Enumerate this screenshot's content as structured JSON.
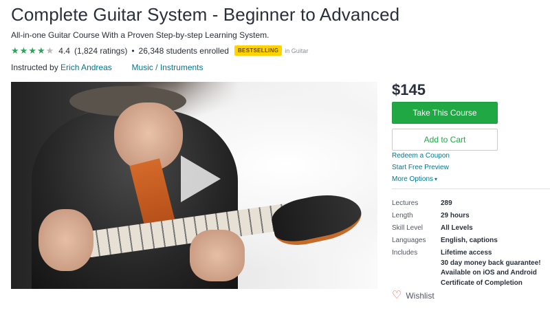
{
  "course": {
    "title": "Complete Guitar System - Beginner to Advanced",
    "subtitle": "All-in-one Guitar Course With a Proven Step-by-step Learning System.",
    "rating_value": "4.4",
    "rating_stars": 4.4,
    "ratings_count": "(1,824 ratings)",
    "separator": "•",
    "students": "26,348 students enrolled",
    "badge": "BESTSELLING",
    "category_note": "in Guitar",
    "instructed_by_label": "Instructed by",
    "instructor": "Erich Andreas",
    "breadcrumb_1": "Music",
    "breadcrumb_sep": "/",
    "breadcrumb_2": "Instruments"
  },
  "video": {
    "play_icon": "play-icon"
  },
  "sidebar": {
    "price": "$145",
    "take_course": "Take This Course",
    "add_to_cart": "Add to Cart",
    "redeem_coupon": "Redeem a Coupon",
    "free_preview": "Start Free Preview",
    "more_options": "More Options",
    "more_options_caret": "▾",
    "details": [
      {
        "label": "Lectures",
        "value": "289"
      },
      {
        "label": "Length",
        "value": "29 hours"
      },
      {
        "label": "Skill Level",
        "value": "All Levels"
      },
      {
        "label": "Languages",
        "value": "English, captions"
      }
    ],
    "includes_label": "Includes",
    "includes": [
      "Lifetime access",
      "30 day money back guarantee!",
      "Available on iOS and Android",
      "Certificate of Completion"
    ],
    "wishlist": "Wishlist",
    "wishlist_icon": "♡"
  },
  "colors": {
    "primary_green": "#20a845",
    "link_teal": "#007791",
    "badge_yellow": "#ffd300",
    "star_gold": "#f4c150",
    "heart_red": "#ec5252"
  }
}
